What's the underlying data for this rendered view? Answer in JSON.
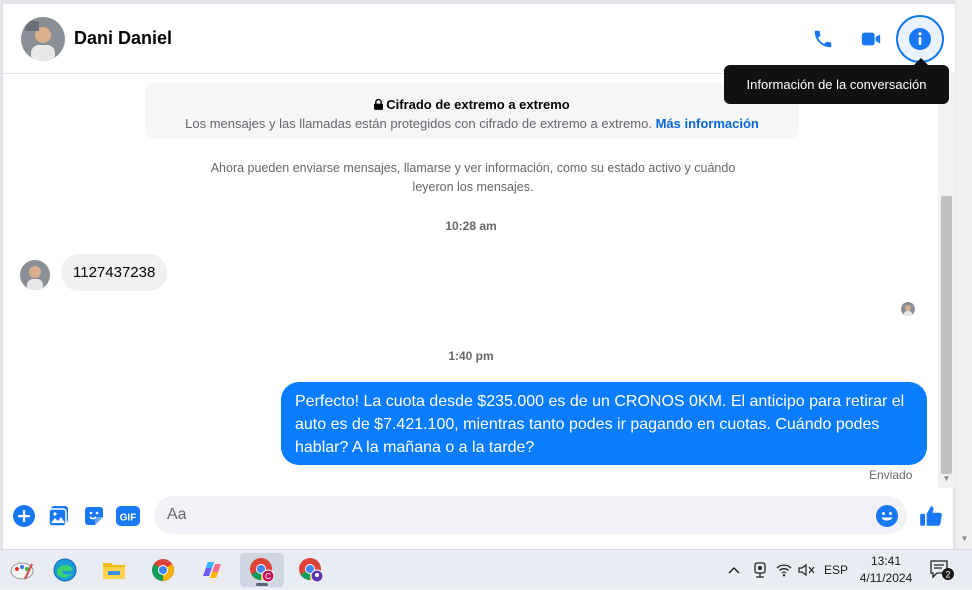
{
  "header": {
    "contact_name": "Dani Daniel",
    "tooltip": "Información de la conversación",
    "icons": [
      "phone-icon",
      "video-icon",
      "info-icon"
    ]
  },
  "encryption": {
    "title": "Cifrado de extremo a extremo",
    "text": "Los mensajes y las llamadas están protegidos con cifrado de extremo a extremo.",
    "link": "Más información"
  },
  "notice": "Ahora pueden enviarse mensajes, llamarse y ver información, como su estado activo y cuándo leyeron los mensajes.",
  "messages": [
    {
      "time": "10:28 am"
    },
    {
      "direction": "incoming",
      "text": "1127437238"
    },
    {
      "time": "1:40 pm"
    },
    {
      "direction": "outgoing",
      "text": "Perfecto! La cuota desde $235.000 es de un CRONOS 0KM. El anticipo para retirar el auto es de $7.421.100, mientras tanto podes ir pagando en cuotas. Cuándo podes hablar? A la mañana o a la tarde?",
      "status": "Enviado"
    }
  ],
  "composer": {
    "placeholder": "Aa",
    "gif_label": "GIF",
    "icons": [
      "plus-icon",
      "photo-icon",
      "sticker-icon",
      "gif-icon",
      "emoji-icon",
      "like-icon"
    ]
  },
  "colors": {
    "accent": "#1877f2",
    "bubble_out": "#0a7cff",
    "bubble_in": "#f0f0f0"
  },
  "taskbar": {
    "apps": [
      "paint-icon",
      "edge-icon",
      "file-explorer-icon",
      "chrome-icon",
      "copilot-icon",
      "chrome-profile-icon",
      "chrome-profile-2-icon"
    ],
    "language": "ESP",
    "time": "13:41",
    "date": "4/11/2024",
    "notifications": "2"
  }
}
